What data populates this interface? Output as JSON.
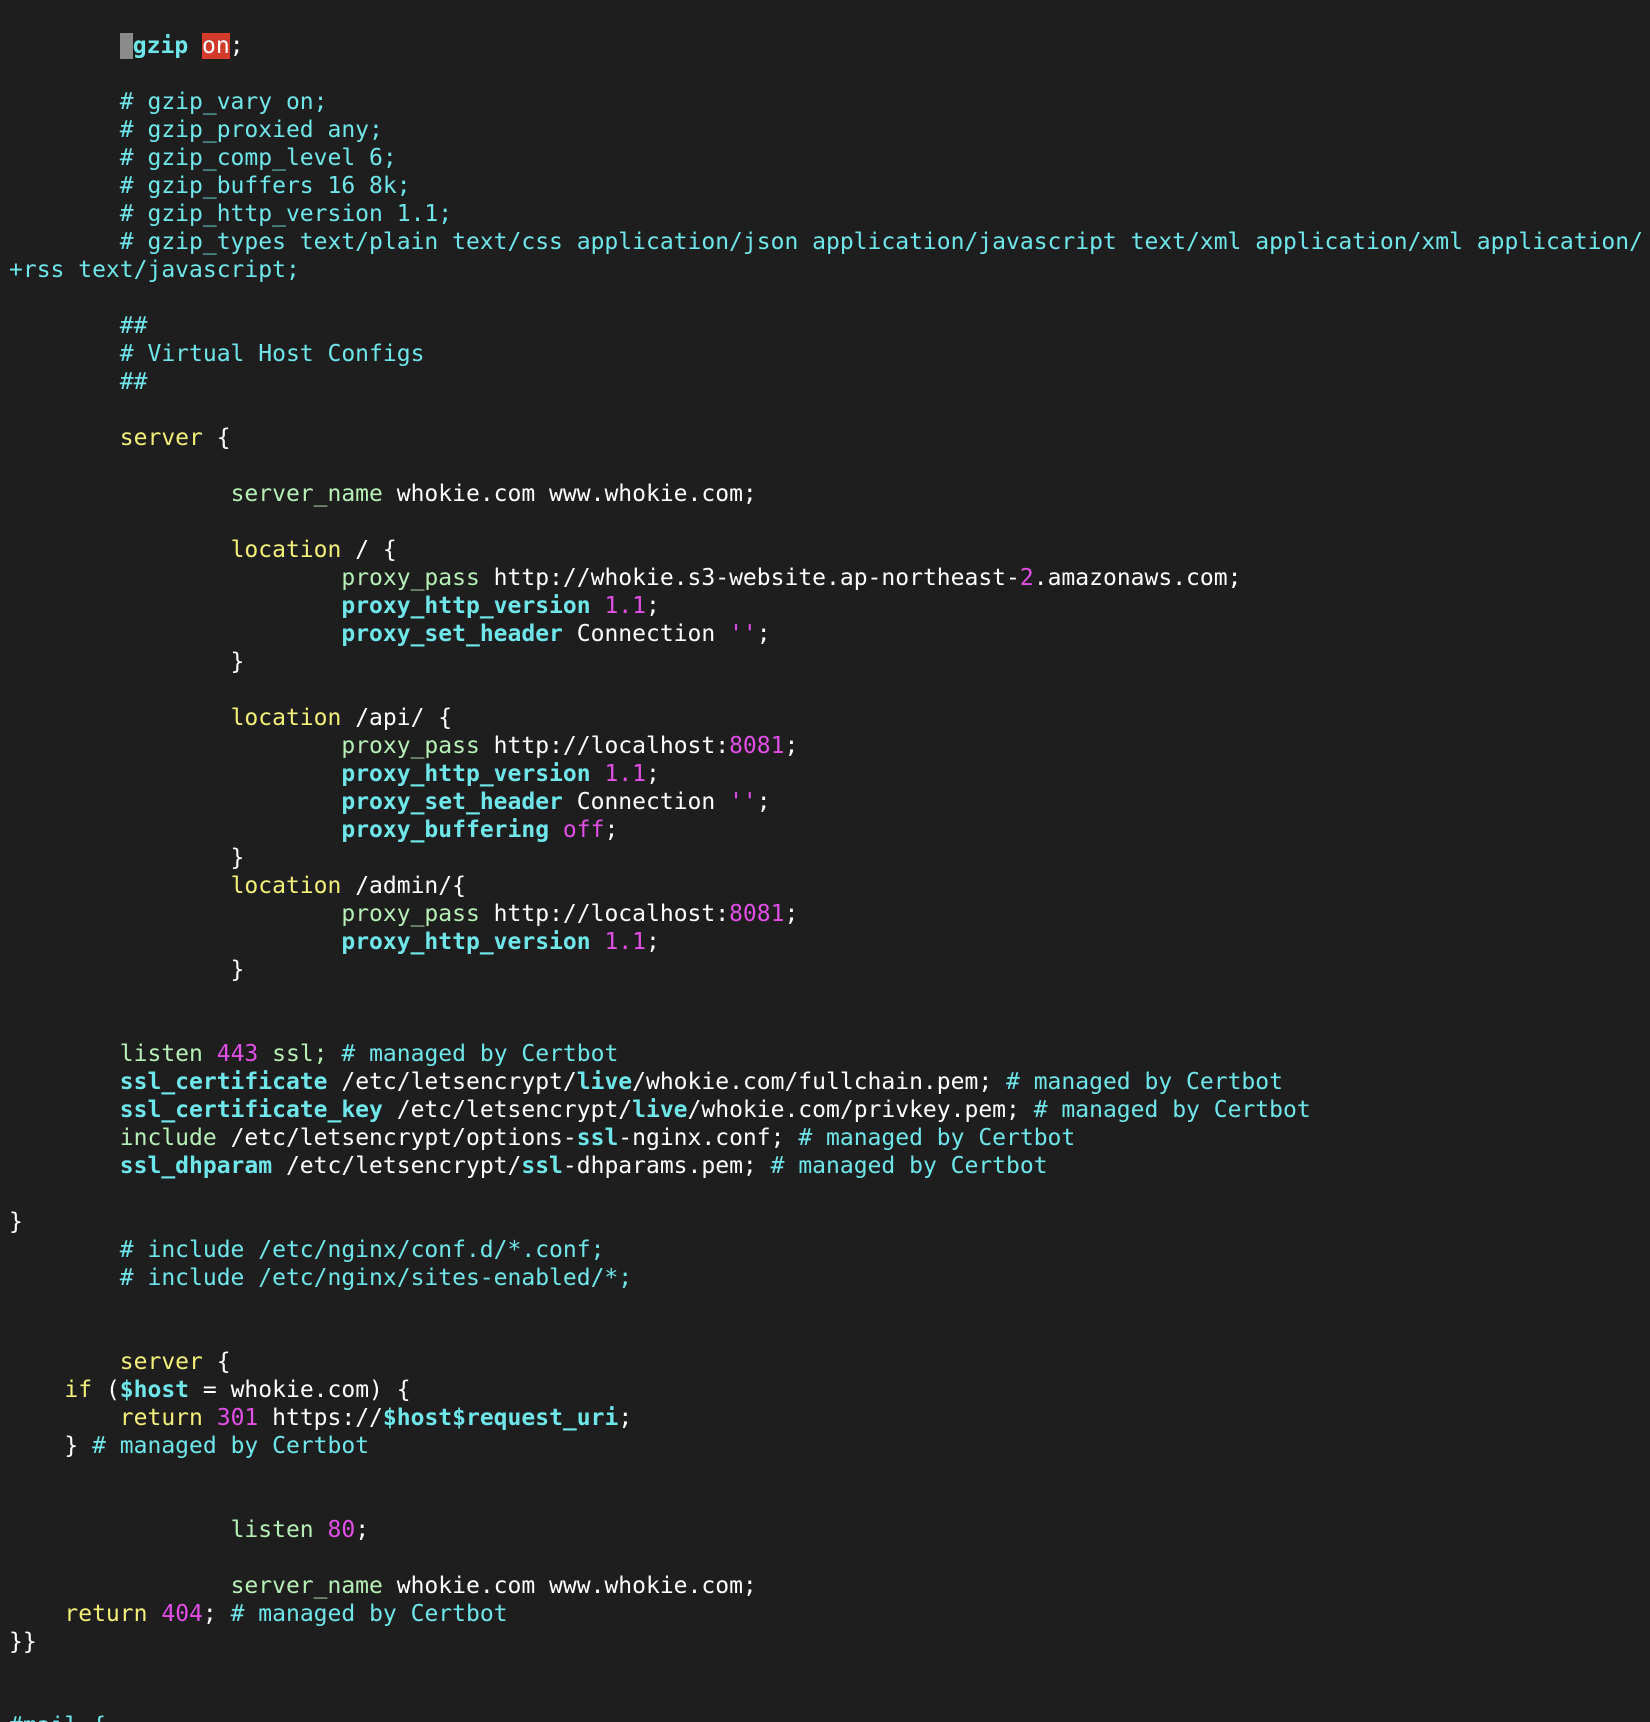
{
  "colors": {
    "background": "#1e1e1e",
    "comment": "#6fe6ea",
    "directive": "#b6f0b6",
    "keyword": "#f3f07a",
    "bold": "#6fe6ea",
    "number": "#e14fe6",
    "plain": "#ffffff",
    "highlight_on": "#d23a2c",
    "cursor": "#8b8b8b"
  },
  "lines": [
    [
      {
        "t": "        ",
        "c": "plain"
      },
      {
        "cursor": true
      },
      {
        "t": "gzip",
        "c": "bold"
      },
      {
        "t": " ",
        "c": "plain"
      },
      {
        "t": "on",
        "c": "highlight-on"
      },
      {
        "t": ";",
        "c": "plain"
      }
    ],
    [],
    [
      {
        "t": "        # gzip_vary on;",
        "c": "comment"
      }
    ],
    [
      {
        "t": "        # gzip_proxied any;",
        "c": "comment"
      }
    ],
    [
      {
        "t": "        # gzip_comp_level 6;",
        "c": "comment"
      }
    ],
    [
      {
        "t": "        # gzip_buffers 16 8k;",
        "c": "comment"
      }
    ],
    [
      {
        "t": "        # gzip_http_version 1.1;",
        "c": "comment"
      }
    ],
    [
      {
        "t": "        # gzip_types text/plain text/css application/json application/javascript text/xml application/xml application/",
        "c": "comment"
      }
    ],
    [
      {
        "t": "+rss text/javascript;",
        "c": "comment"
      }
    ],
    [],
    [
      {
        "t": "        ##",
        "c": "comment"
      }
    ],
    [
      {
        "t": "        # Virtual Host Configs",
        "c": "comment"
      }
    ],
    [
      {
        "t": "        ##",
        "c": "comment"
      }
    ],
    [],
    [
      {
        "t": "        ",
        "c": "plain"
      },
      {
        "t": "server",
        "c": "keyword"
      },
      {
        "t": " {",
        "c": "plain"
      }
    ],
    [],
    [
      {
        "t": "                ",
        "c": "plain"
      },
      {
        "t": "server_name",
        "c": "directive"
      },
      {
        "t": " whokie.com www.whokie.com;",
        "c": "plain"
      }
    ],
    [],
    [
      {
        "t": "                ",
        "c": "plain"
      },
      {
        "t": "location",
        "c": "keyword"
      },
      {
        "t": " / {",
        "c": "plain"
      }
    ],
    [
      {
        "t": "                        ",
        "c": "plain"
      },
      {
        "t": "proxy_pass",
        "c": "directive"
      },
      {
        "t": " http://whokie.s3-website.ap-northeast-",
        "c": "plain"
      },
      {
        "t": "2",
        "c": "number"
      },
      {
        "t": ".amazonaws.com;",
        "c": "plain"
      }
    ],
    [
      {
        "t": "                        ",
        "c": "plain"
      },
      {
        "t": "proxy_http_version",
        "c": "bold"
      },
      {
        "t": " ",
        "c": "plain"
      },
      {
        "t": "1.1",
        "c": "number"
      },
      {
        "t": ";",
        "c": "plain"
      }
    ],
    [
      {
        "t": "                        ",
        "c": "plain"
      },
      {
        "t": "proxy_set_header",
        "c": "bold"
      },
      {
        "t": " Connection ",
        "c": "plain"
      },
      {
        "t": "''",
        "c": "string"
      },
      {
        "t": ";",
        "c": "plain"
      }
    ],
    [
      {
        "t": "                }",
        "c": "plain"
      }
    ],
    [],
    [
      {
        "t": "                ",
        "c": "plain"
      },
      {
        "t": "location",
        "c": "keyword"
      },
      {
        "t": " /api/ {",
        "c": "plain"
      }
    ],
    [
      {
        "t": "                        ",
        "c": "plain"
      },
      {
        "t": "proxy_pass",
        "c": "directive"
      },
      {
        "t": " http://localhost:",
        "c": "plain"
      },
      {
        "t": "8081",
        "c": "number"
      },
      {
        "t": ";",
        "c": "plain"
      }
    ],
    [
      {
        "t": "                        ",
        "c": "plain"
      },
      {
        "t": "proxy_http_version",
        "c": "bold"
      },
      {
        "t": " ",
        "c": "plain"
      },
      {
        "t": "1.1",
        "c": "number"
      },
      {
        "t": ";",
        "c": "plain"
      }
    ],
    [
      {
        "t": "                        ",
        "c": "plain"
      },
      {
        "t": "proxy_set_header",
        "c": "bold"
      },
      {
        "t": " Connection ",
        "c": "plain"
      },
      {
        "t": "''",
        "c": "string"
      },
      {
        "t": ";",
        "c": "plain"
      }
    ],
    [
      {
        "t": "                        ",
        "c": "plain"
      },
      {
        "t": "proxy_buffering",
        "c": "bold"
      },
      {
        "t": " ",
        "c": "plain"
      },
      {
        "t": "off",
        "c": "boolean"
      },
      {
        "t": ";",
        "c": "plain"
      }
    ],
    [
      {
        "t": "                }",
        "c": "plain"
      }
    ],
    [
      {
        "t": "                ",
        "c": "plain"
      },
      {
        "t": "location",
        "c": "keyword"
      },
      {
        "t": " /admin/{",
        "c": "plain"
      }
    ],
    [
      {
        "t": "                        ",
        "c": "plain"
      },
      {
        "t": "proxy_pass",
        "c": "directive"
      },
      {
        "t": " http://localhost:",
        "c": "plain"
      },
      {
        "t": "8081",
        "c": "number"
      },
      {
        "t": ";",
        "c": "plain"
      }
    ],
    [
      {
        "t": "                        ",
        "c": "plain"
      },
      {
        "t": "proxy_http_version",
        "c": "bold"
      },
      {
        "t": " ",
        "c": "plain"
      },
      {
        "t": "1.1",
        "c": "number"
      },
      {
        "t": ";",
        "c": "plain"
      }
    ],
    [
      {
        "t": "                }",
        "c": "plain"
      }
    ],
    [],
    [],
    [
      {
        "t": "        ",
        "c": "plain"
      },
      {
        "t": "listen",
        "c": "directive"
      },
      {
        "t": " ",
        "c": "plain"
      },
      {
        "t": "443",
        "c": "number"
      },
      {
        "t": " ssl; ",
        "c": "directive"
      },
      {
        "t": "# managed by Certbot",
        "c": "comment"
      }
    ],
    [
      {
        "t": "        ",
        "c": "plain"
      },
      {
        "t": "ssl_certificate",
        "c": "bold"
      },
      {
        "t": " /etc/letsencrypt/",
        "c": "plain"
      },
      {
        "t": "live",
        "c": "bold"
      },
      {
        "t": "/whokie.com/fullchain.pem; ",
        "c": "plain"
      },
      {
        "t": "# managed by Certbot",
        "c": "comment"
      }
    ],
    [
      {
        "t": "        ",
        "c": "plain"
      },
      {
        "t": "ssl_certificate_key",
        "c": "bold"
      },
      {
        "t": " /etc/letsencrypt/",
        "c": "plain"
      },
      {
        "t": "live",
        "c": "bold"
      },
      {
        "t": "/whokie.com/privkey.pem; ",
        "c": "plain"
      },
      {
        "t": "# managed by Certbot",
        "c": "comment"
      }
    ],
    [
      {
        "t": "        ",
        "c": "plain"
      },
      {
        "t": "include",
        "c": "directive"
      },
      {
        "t": " /etc/letsencrypt/options-",
        "c": "plain"
      },
      {
        "t": "ssl",
        "c": "bold"
      },
      {
        "t": "-nginx.conf; ",
        "c": "plain"
      },
      {
        "t": "# managed by Certbot",
        "c": "comment"
      }
    ],
    [
      {
        "t": "        ",
        "c": "plain"
      },
      {
        "t": "ssl_dhparam",
        "c": "bold"
      },
      {
        "t": " /etc/letsencrypt/",
        "c": "plain"
      },
      {
        "t": "ssl",
        "c": "bold"
      },
      {
        "t": "-dhparams.pem; ",
        "c": "plain"
      },
      {
        "t": "# managed by Certbot",
        "c": "comment"
      }
    ],
    [],
    [
      {
        "t": "}",
        "c": "plain"
      }
    ],
    [
      {
        "t": "        # include /etc/nginx/conf.d/*.conf;",
        "c": "comment"
      }
    ],
    [
      {
        "t": "        # include /etc/nginx/sites-enabled/*;",
        "c": "comment"
      }
    ],
    [],
    [],
    [
      {
        "t": "        ",
        "c": "plain"
      },
      {
        "t": "server",
        "c": "keyword"
      },
      {
        "t": " {",
        "c": "plain"
      }
    ],
    [
      {
        "t": "    ",
        "c": "plain"
      },
      {
        "t": "if",
        "c": "keyword"
      },
      {
        "t": " (",
        "c": "plain"
      },
      {
        "t": "$host",
        "c": "bold"
      },
      {
        "t": " = whokie.com) {",
        "c": "plain"
      }
    ],
    [
      {
        "t": "        ",
        "c": "plain"
      },
      {
        "t": "return",
        "c": "keyword"
      },
      {
        "t": " ",
        "c": "plain"
      },
      {
        "t": "301",
        "c": "number"
      },
      {
        "t": " https://",
        "c": "plain"
      },
      {
        "t": "$host$request_uri",
        "c": "bold"
      },
      {
        "t": ";",
        "c": "plain"
      }
    ],
    [
      {
        "t": "    } ",
        "c": "plain"
      },
      {
        "t": "# managed by Certbot",
        "c": "comment"
      }
    ],
    [],
    [],
    [
      {
        "t": "                ",
        "c": "plain"
      },
      {
        "t": "listen",
        "c": "directive"
      },
      {
        "t": " ",
        "c": "plain"
      },
      {
        "t": "80",
        "c": "number"
      },
      {
        "t": ";",
        "c": "plain"
      }
    ],
    [],
    [
      {
        "t": "                ",
        "c": "plain"
      },
      {
        "t": "server_name",
        "c": "directive"
      },
      {
        "t": " whokie.com www.whokie.com;",
        "c": "plain"
      }
    ],
    [
      {
        "t": "    ",
        "c": "plain"
      },
      {
        "t": "return",
        "c": "keyword"
      },
      {
        "t": " ",
        "c": "plain"
      },
      {
        "t": "404",
        "c": "number"
      },
      {
        "t": "; ",
        "c": "plain"
      },
      {
        "t": "# managed by Certbot",
        "c": "comment"
      }
    ],
    [
      {
        "t": "}}",
        "c": "plain"
      }
    ],
    [],
    [],
    [
      {
        "t": "#mail {",
        "c": "comment"
      }
    ]
  ]
}
